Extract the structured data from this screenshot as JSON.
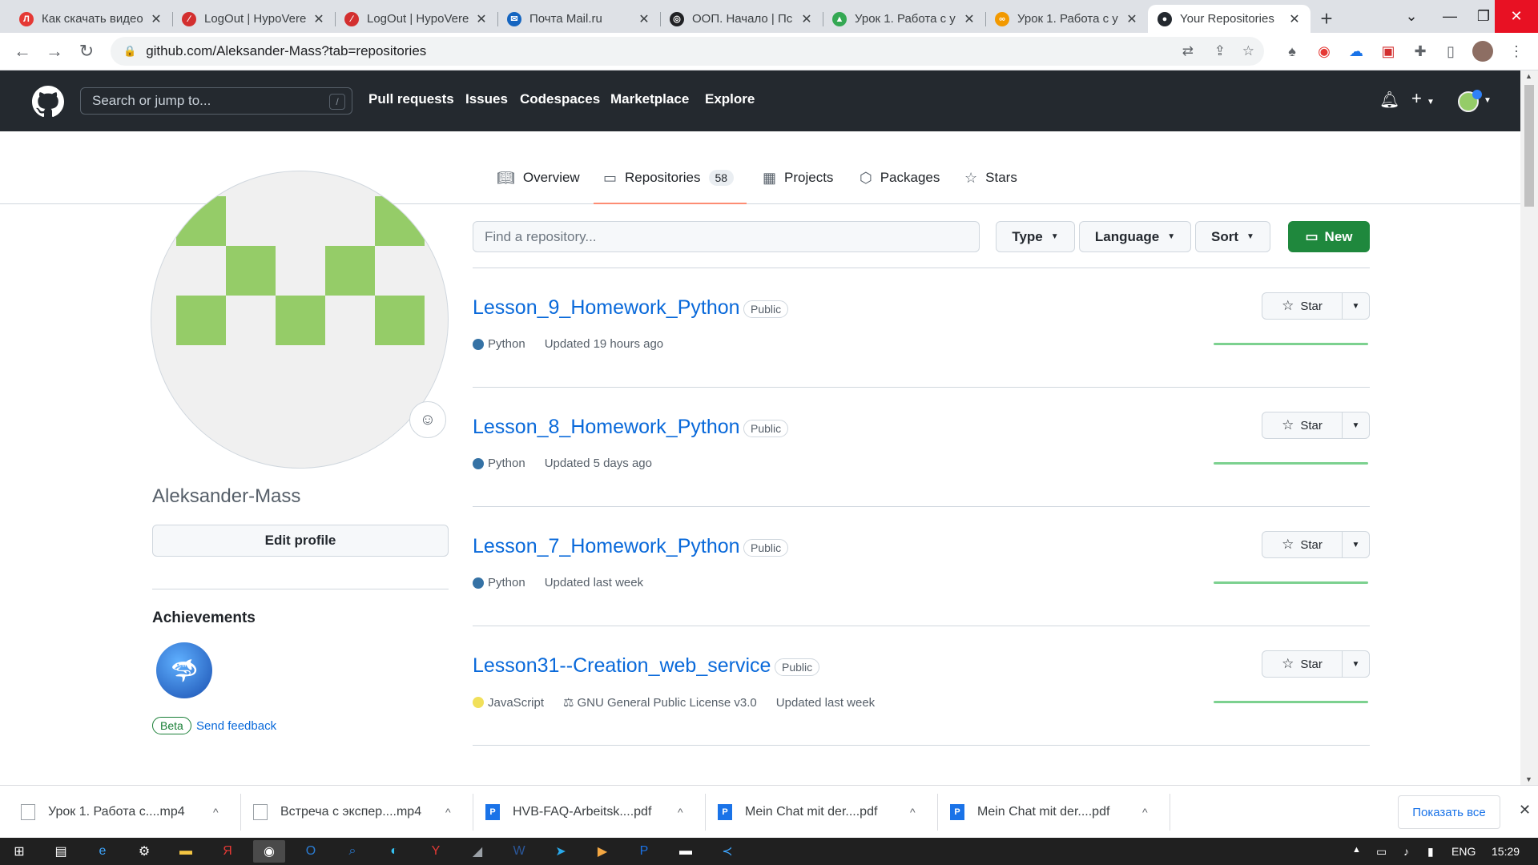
{
  "browser": {
    "tabs": [
      {
        "title": "Как скачать видео",
        "favicon_color": "#e53935",
        "favicon_glyph": "Л"
      },
      {
        "title": "LogOut | HypoVere",
        "favicon_color": "#d32f2f",
        "favicon_glyph": "∕"
      },
      {
        "title": "LogOut | HypoVere",
        "favicon_color": "#d32f2f",
        "favicon_glyph": "∕"
      },
      {
        "title": "Почта Mail.ru",
        "favicon_color": "#1565c0",
        "favicon_glyph": "✉"
      },
      {
        "title": "ООП. Начало | Пс",
        "favicon_color": "#202124",
        "favicon_glyph": "◎"
      },
      {
        "title": "Урок 1. Работа с у",
        "favicon_color": "#34a853",
        "favicon_glyph": "▲"
      },
      {
        "title": "Урок 1. Работа с у",
        "favicon_color": "#f29900",
        "favicon_glyph": "∞"
      },
      {
        "title": "Your Repositories",
        "favicon_color": "#24292f",
        "favicon_glyph": "●"
      }
    ],
    "url": "github.com/Aleksander-Mass?tab=repositories"
  },
  "header": {
    "search_placeholder": "Search or jump to...",
    "slash_key": "/",
    "nav": [
      "Pull requests",
      "Issues",
      "Codespaces",
      "Marketplace",
      "Explore"
    ]
  },
  "profile_tabs": {
    "overview": "Overview",
    "repositories": "Repositories",
    "repositories_count": "58",
    "projects": "Projects",
    "packages": "Packages",
    "stars": "Stars"
  },
  "sidebar": {
    "username": "Aleksander-Mass",
    "edit_profile": "Edit profile",
    "achievements_title": "Achievements",
    "beta_label": "Beta",
    "feedback_label": "Send feedback"
  },
  "filters": {
    "find_placeholder": "Find a repository...",
    "type": "Type",
    "language": "Language",
    "sort": "Sort",
    "new": "New"
  },
  "repos": [
    {
      "name": "Lesson_9_Homework_Python",
      "visibility": "Public",
      "language": "Python",
      "language_color": "#3572A5",
      "license": "",
      "updated": "Updated 19 hours ago",
      "star_label": "Star"
    },
    {
      "name": "Lesson_8_Homework_Python",
      "visibility": "Public",
      "language": "Python",
      "language_color": "#3572A5",
      "license": "",
      "updated": "Updated 5 days ago",
      "star_label": "Star"
    },
    {
      "name": "Lesson_7_Homework_Python",
      "visibility": "Public",
      "language": "Python",
      "language_color": "#3572A5",
      "license": "",
      "updated": "Updated last week",
      "star_label": "Star"
    },
    {
      "name": "Lesson31--Creation_web_service",
      "visibility": "Public",
      "language": "JavaScript",
      "language_color": "#f1e05a",
      "license": "GNU General Public License v3.0",
      "updated": "Updated last week",
      "star_label": "Star"
    }
  ],
  "downloads": [
    {
      "name": "Урок 1. Работа с....mp4",
      "type": "video"
    },
    {
      "name": "Встреча с экспер....mp4",
      "type": "video"
    },
    {
      "name": "HVB-FAQ-Arbeitsk....pdf",
      "type": "pdf"
    },
    {
      "name": "Mein Chat mit der....pdf",
      "type": "pdf"
    },
    {
      "name": "Mein Chat mit der....pdf",
      "type": "pdf"
    }
  ],
  "show_all": "Показать все",
  "taskbar": {
    "lang": "ENG",
    "time": "15:29"
  }
}
